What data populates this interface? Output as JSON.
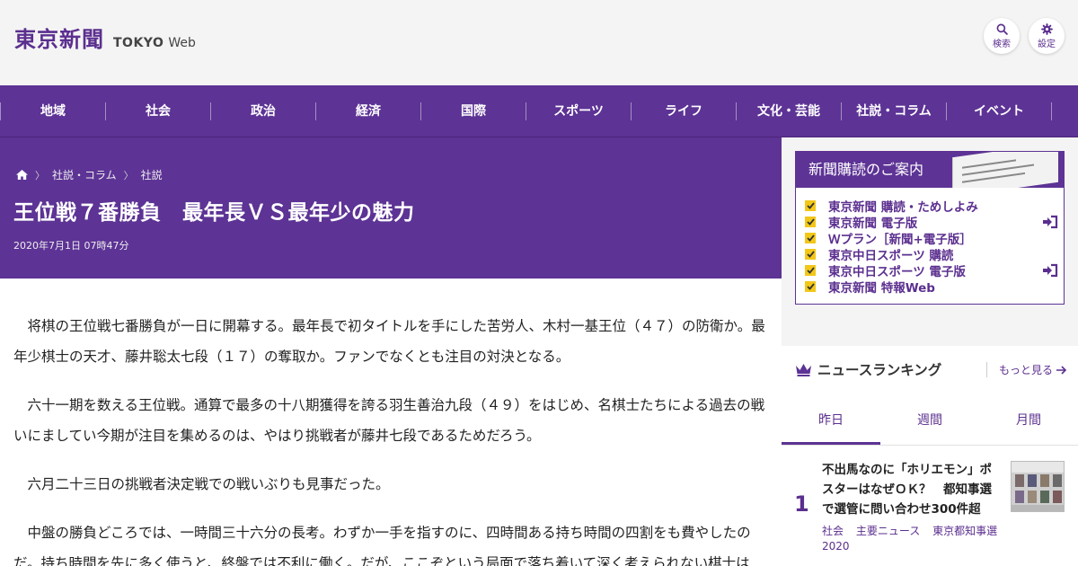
{
  "header": {
    "logo_main": "東京新聞",
    "logo_sub1": "TOKYO",
    "logo_sub2": "Web",
    "search_label": "検索",
    "settings_label": "設定"
  },
  "nav": {
    "items": [
      "地域",
      "社会",
      "政治",
      "経済",
      "国際",
      "スポーツ",
      "ライフ",
      "文化・芸能",
      "社説・コラム",
      "イベント"
    ]
  },
  "article": {
    "breadcrumb": [
      "社説・コラム",
      "社説"
    ],
    "title": "王位戦７番勝負　最年長ＶＳ最年少の魅力",
    "date": "2020年7月1日 07時47分",
    "paragraphs": [
      "将棋の王位戦七番勝負が一日に開幕する。最年長で初タイトルを手にした苦労人、木村一基王位（４７）の防衛か。最年少棋士の天才、藤井聡太七段（１７）の奪取か。ファンでなくとも注目の対決となる。",
      "六十一期を数える王位戦。通算で最多の十八期獲得を誇る羽生善治九段（４９）をはじめ、名棋士たちによる過去の戦いにましてい今期が注目を集めるのは、やはり挑戦者が藤井七段であるためだろう。",
      "六月二十三日の挑戦者決定戦での戦いぶりも見事だった。",
      "中盤の勝負どころでは、一時間三十六分の長考。わずか一手を指すのに、四時間ある持ち時間の四割をも費やしたのだ。持ち時間を先に多く使うと、終盤では不利に働く。だが、ここぞという局面で落ち着いて深く考えられない棋士は"
    ]
  },
  "promo": {
    "heading": "新聞購読のご案内",
    "links": [
      "東京新聞 購読・ためしよみ",
      "東京新聞 電子版",
      "Ｗプラン［新聞+電子版］",
      "東京中日スポーツ 購読",
      "東京中日スポーツ 電子版",
      "東京新聞 特報Web"
    ]
  },
  "ranking": {
    "title": "ニュースランキング",
    "more": "もっと見る",
    "tabs": [
      "昨日",
      "週間",
      "月間"
    ],
    "item": {
      "rank": "1",
      "title": "不出馬なのに「ホリエモン」ポスターはなぜＯＫ？　都知事選で選管に問い合わせ300件超",
      "tags": [
        "社会",
        "主要ニュース",
        "東京都知事選2020"
      ]
    }
  },
  "colors": {
    "brand_purple": "#5d3395",
    "check_yellow": "#f2c718"
  }
}
